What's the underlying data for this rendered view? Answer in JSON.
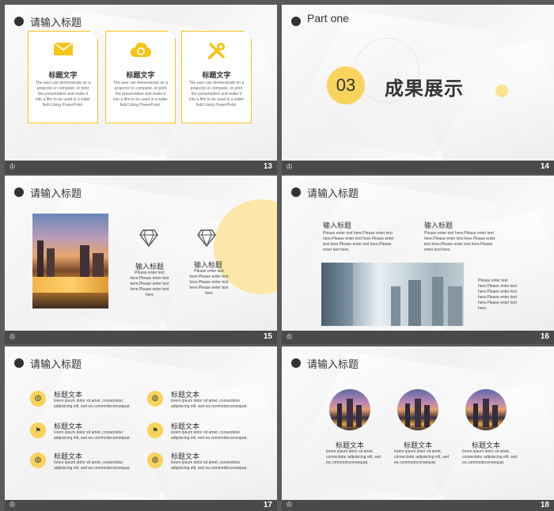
{
  "slides": {
    "s13": {
      "title": "请输入标题",
      "num": "13",
      "cards": [
        {
          "icon": "envelope-icon",
          "glyph": "✉",
          "heading": "标题文字",
          "desc": "The user can demonstrate on a projector or computer, or print the presentation and make it into a film to be used in a wider field Using PowerPoint."
        },
        {
          "icon": "cloud-refresh-icon",
          "glyph": "☁",
          "heading": "标题文字",
          "desc": "The user can demonstrate on a projector or computer, or print the presentation and make it into a film to be used in a wider field Using PowerPoint."
        },
        {
          "icon": "tools-icon",
          "glyph": "✂",
          "heading": "标题文字",
          "desc": "The user can demonstrate on a projector or computer, or print the presentation and make it into a film to be used in a wider field Using PowerPoint."
        }
      ]
    },
    "s14": {
      "part": "Part one",
      "number": "03",
      "heading": "成果展示",
      "num": "14"
    },
    "s15": {
      "title": "请输入标题",
      "num": "15",
      "items": [
        {
          "heading": "输入标题",
          "desc": "Please enter text here.Please enter text here.Please enter text here.Please enter text here"
        },
        {
          "heading": "输入标题",
          "desc": "Please enter text here.Please enter text here.Please enter text here.Please enter text here"
        }
      ]
    },
    "s16": {
      "title": "请输入标题",
      "num": "16",
      "cols": [
        {
          "heading": "输入标题",
          "desc": "Please enter text here.Please enter text here.Please enter text here.Please enter text here.Please enter text here.Please enter text here."
        },
        {
          "heading": "输入标题",
          "desc": "Please enter text here.Please enter text here.Please enter text here.Please enter text here.Please enter text here.Please enter text here."
        }
      ],
      "side": "Please enter text here.Please enter text here.Please enter text here.Please enter text here.Please enter text here."
    },
    "s17": {
      "title": "请输入标题",
      "num": "17",
      "items": [
        {
          "heading": "标题文本",
          "desc": "lorem ipsum dolor sit amet, consectetur adipisicing elit, sed ea commodoconsequat."
        },
        {
          "heading": "标题文本",
          "desc": "lorem ipsum dolor sit amet, consectetur adipisicing elit, sed ea commodoconsequat."
        },
        {
          "heading": "标题文本",
          "desc": "lorem ipsum dolor sit amet, consectetur adipisicing elit, sed ea commodoconsequat."
        },
        {
          "heading": "标题文本",
          "desc": "lorem ipsum dolor sit amet, consectetur adipisicing elit, sed ea commodoconsequat."
        },
        {
          "heading": "标题文本",
          "desc": "lorem ipsum dolor sit amet, consectetur adipisicing elit, sed ea commodoconsequat."
        },
        {
          "heading": "标题文本",
          "desc": "lorem ipsum dolor sit amet, consectetur adipisicing elit, sed ea commodoconsequat."
        }
      ]
    },
    "s18": {
      "title": "请输入标题",
      "num": "18",
      "items": [
        {
          "heading": "标题文本",
          "desc": "lorem ipsum dolor sit amet, consectetur adipisicing elit, sed ea commodoconsequat."
        },
        {
          "heading": "标题文本",
          "desc": "lorem ipsum dolor sit amet, consectetur adipisicing elit, sed ea commodoconsequat."
        },
        {
          "heading": "标题文本",
          "desc": "lorem ipsum dolor sit amet, consectetur adipisicing elit, sed ea commodoconsequat."
        }
      ]
    }
  },
  "colors": {
    "accent": "#f5c518",
    "footer": "#4a4a4a",
    "bg": "#5a5a5a"
  }
}
